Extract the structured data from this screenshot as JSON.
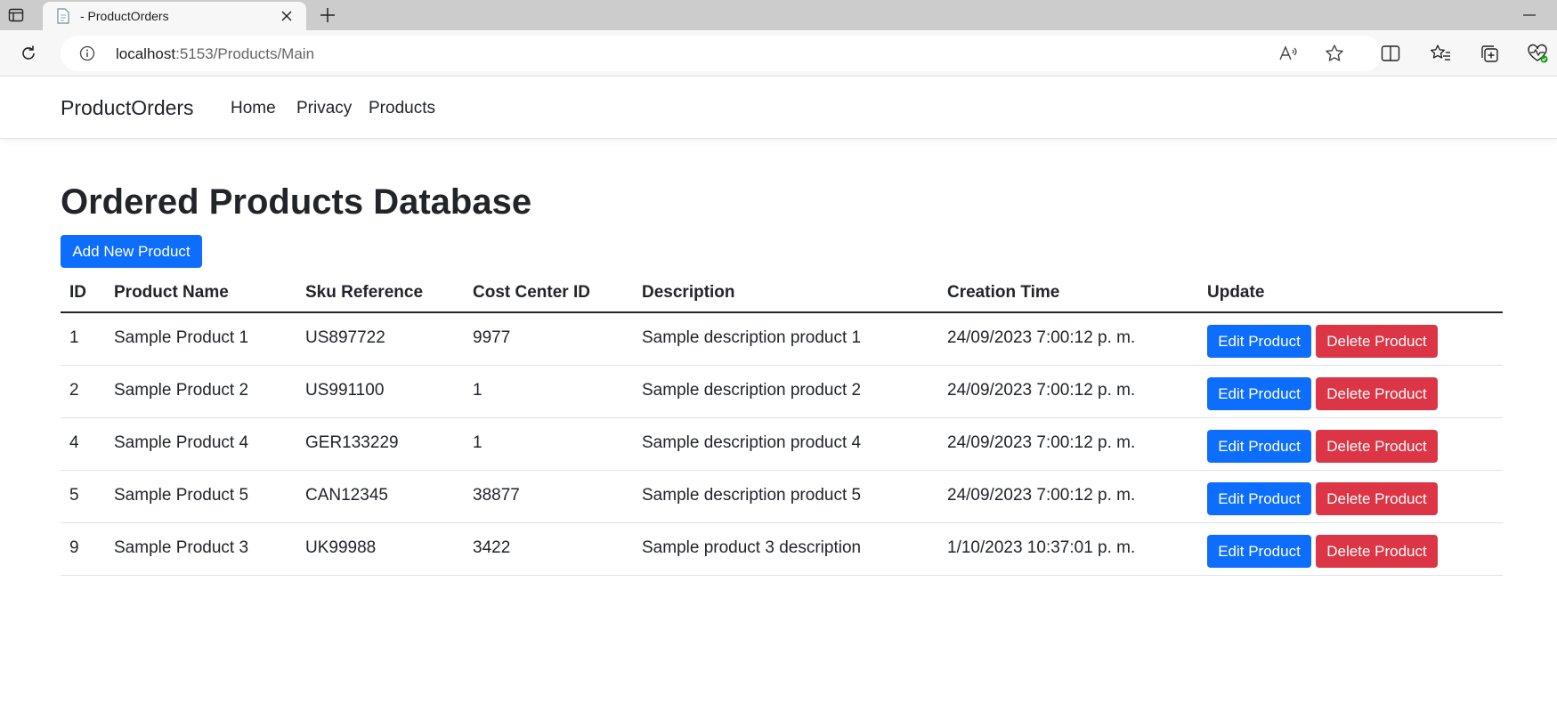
{
  "browser": {
    "tab_title": "- ProductOrders",
    "url_host": "localhost",
    "url_rest": ":5153/Products/Main"
  },
  "site": {
    "brand": "ProductOrders",
    "nav": [
      {
        "label": "Home"
      },
      {
        "label": "Privacy"
      },
      {
        "label": "Products"
      }
    ]
  },
  "main": {
    "title": "Ordered Products Database",
    "add_button": "Add New Product",
    "columns": [
      "ID",
      "Product Name",
      "Sku Reference",
      "Cost Center ID",
      "Description",
      "Creation Time",
      "Update"
    ],
    "rows": [
      {
        "id": "1",
        "name": "Sample Product 1",
        "sku": "US897722",
        "cost_center": "9977",
        "description": "Sample description product 1",
        "created": "24/09/2023 7:00:12 p. m.",
        "edit": "Edit Product",
        "delete": "Delete Product"
      },
      {
        "id": "2",
        "name": "Sample Product 2",
        "sku": "US991100",
        "cost_center": "1",
        "description": "Sample description product 2",
        "created": "24/09/2023 7:00:12 p. m.",
        "edit": "Edit Product",
        "delete": "Delete Product"
      },
      {
        "id": "4",
        "name": "Sample Product 4",
        "sku": "GER133229",
        "cost_center": "1",
        "description": "Sample description product 4",
        "created": "24/09/2023 7:00:12 p. m.",
        "edit": "Edit Product",
        "delete": "Delete Product"
      },
      {
        "id": "5",
        "name": "Sample Product 5",
        "sku": "CAN12345",
        "cost_center": "38877",
        "description": "Sample description product 5",
        "created": "24/09/2023 7:00:12 p. m.",
        "edit": "Edit Product",
        "delete": "Delete Product"
      },
      {
        "id": "9",
        "name": "Sample Product 3",
        "sku": "UK99988",
        "cost_center": "3422",
        "description": "Sample product 3 description",
        "created": "1/10/2023 10:37:01 p. m.",
        "edit": "Edit Product",
        "delete": "Delete Product"
      }
    ]
  },
  "colors": {
    "primary": "#0d6efd",
    "danger": "#dc3545",
    "text": "#212529"
  },
  "icons": [
    "tab-actions-icon",
    "page-favicon-icon",
    "close-icon",
    "plus-icon",
    "minimize-icon",
    "reload-icon",
    "info-icon",
    "read-aloud-icon",
    "favorite-star-icon",
    "split-screen-icon",
    "favorites-icon",
    "collections-icon",
    "browser-essentials-icon"
  ]
}
